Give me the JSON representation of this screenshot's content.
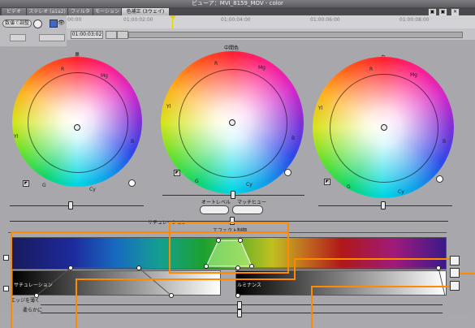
{
  "window": {
    "title": "ビューア：MVI_8159_MOV - color"
  },
  "tabs": [
    {
      "label": "ビデオ"
    },
    {
      "label": "ステレオ (a1a2)"
    },
    {
      "label": "フィルタ"
    },
    {
      "label": "モーション"
    },
    {
      "label": "色補正 (3ウェイ)"
    }
  ],
  "controls": {
    "numeric_button": "数値で調整"
  },
  "ruler": {
    "start": "00:00",
    "ticks": [
      "01:00:02:00",
      "01:00:04:00",
      "01:00:06:00",
      "01:00:08:00"
    ],
    "timecode": "01:00:03:02"
  },
  "wheels": [
    {
      "title": "黒",
      "label_r": "R",
      "label_mg": "Mg",
      "label_b": "B",
      "label_cy": "Cy",
      "label_g": "G",
      "label_yl": "Yl"
    },
    {
      "title": "中間色",
      "label_r": "R",
      "label_mg": "Mg",
      "label_b": "B",
      "label_cy": "Cy",
      "label_g": "G",
      "label_yl": "Yl"
    },
    {
      "title": "白",
      "label_r": "R",
      "label_mg": "Mg",
      "label_b": "B",
      "label_cy": "Cy",
      "label_g": "G",
      "label_yl": "Yl"
    }
  ],
  "auto": {
    "autolevel": "オートレベル",
    "match": "マッチヒュー"
  },
  "saturation_label": "サチュレーション",
  "effect": {
    "label": "エフェクト制御"
  },
  "sat_bar_label": "サチュレーション",
  "lum_bar_label": "ルミナンス",
  "edge_thin": "エッジを薄く",
  "soften": "柔らかに",
  "icons": {
    "close": "close-icon",
    "picker": "eyedropper-icon"
  },
  "colors": {
    "callout": "#ff8a00",
    "accent_playhead": "#e8d000"
  }
}
